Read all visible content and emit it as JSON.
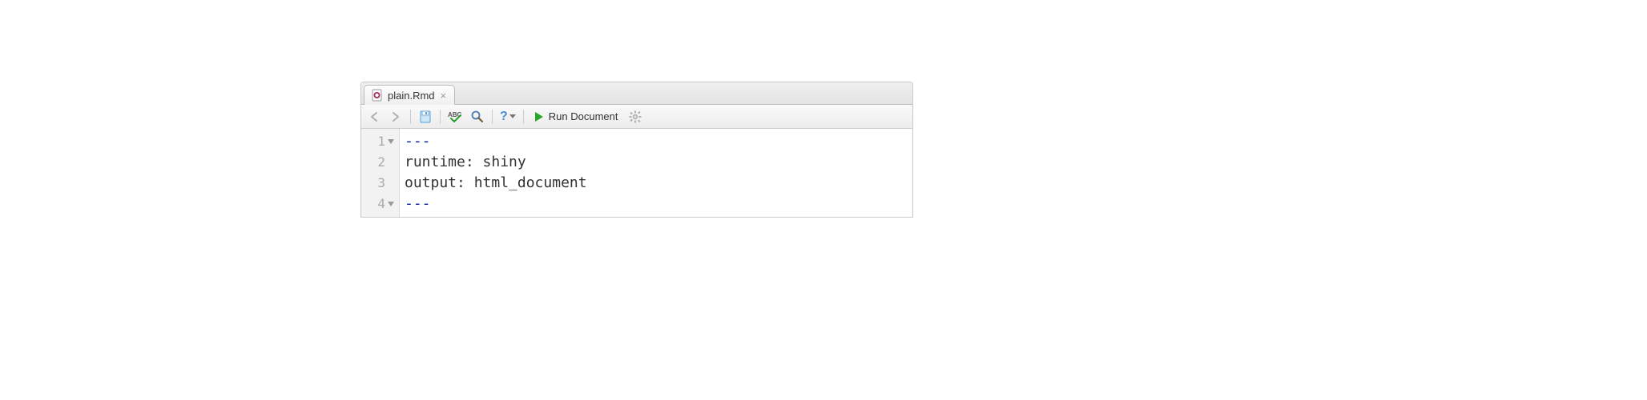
{
  "tab": {
    "filename": "plain.Rmd"
  },
  "toolbar": {
    "run_label": "Run Document",
    "help_label": "?"
  },
  "code": {
    "lines": [
      {
        "num": "1",
        "text": "---",
        "class": "yaml-delim",
        "fold": true
      },
      {
        "num": "2",
        "text": "runtime: shiny",
        "class": "",
        "fold": false
      },
      {
        "num": "3",
        "text": "output: html_document",
        "class": "",
        "fold": false
      },
      {
        "num": "4",
        "text": "---",
        "class": "yaml-delim",
        "fold": true
      }
    ]
  }
}
